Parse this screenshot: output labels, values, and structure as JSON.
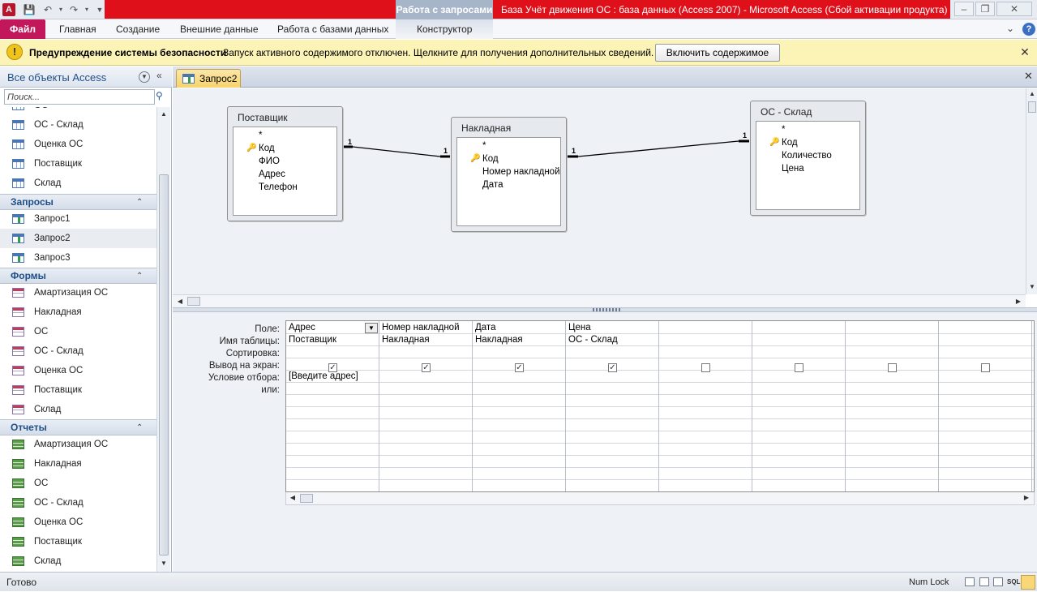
{
  "titlebar": {
    "context_label": "Работа с запросами",
    "app_title": "База Учёт движения ОС : база данных (Access 2007)  -  Microsoft Access (Сбой активации продукта)"
  },
  "ribbon": {
    "file": "Файл",
    "tabs": [
      "Главная",
      "Создание",
      "Внешние данные",
      "Работа с базами данных",
      "Конструктор"
    ]
  },
  "security": {
    "title": "Предупреждение системы безопасности",
    "message": "Запуск активного содержимого отключен. Щелкните для получения дополнительных сведений.",
    "button": "Включить содержимое"
  },
  "nav": {
    "header": "Все объекты Access",
    "search_placeholder": "Поиск...",
    "tables": [
      "ОС",
      "ОС - Склад",
      "Оценка ОС",
      "Поставщик",
      "Склад"
    ],
    "groups": {
      "queries": "Запросы",
      "forms": "Формы",
      "reports": "Отчеты"
    },
    "queries": [
      "Запрос1",
      "Запрос2",
      "Запрос3"
    ],
    "forms": [
      "Амартизация ОС",
      "Накладная",
      "ОС",
      "ОС - Склад",
      "Оценка ОС",
      "Поставщик",
      "Склад"
    ],
    "reports": [
      "Амартизация ОС",
      "Накладная",
      "ОС",
      "ОС - Склад",
      "Оценка ОС",
      "Поставщик",
      "Склад"
    ]
  },
  "doc": {
    "tab": "Запрос2",
    "tables": [
      {
        "name": "Поставщик",
        "fields": [
          "*",
          "Код",
          "ФИО",
          "Адрес",
          "Телефон"
        ]
      },
      {
        "name": "Накладная",
        "fields": [
          "*",
          "Код",
          "Номер накладной",
          "Дата"
        ]
      },
      {
        "name": "ОС - Склад",
        "fields": [
          "*",
          "Код",
          "Количество",
          "Цена"
        ]
      }
    ],
    "rel_label": "1"
  },
  "grid": {
    "row_labels": [
      "Поле:",
      "Имя таблицы:",
      "Сортировка:",
      "Вывод на экран:",
      "Условие отбора:",
      "или:"
    ],
    "fields": [
      "Адрес",
      "Номер накладной",
      "Дата",
      "Цена"
    ],
    "tables": [
      "Поставщик",
      "Накладная",
      "Накладная",
      "ОС - Склад"
    ],
    "criteria": "[Введите адрес]"
  },
  "status": {
    "ready": "Готово",
    "numlock": "Num Lock",
    "sql": "SQL"
  }
}
